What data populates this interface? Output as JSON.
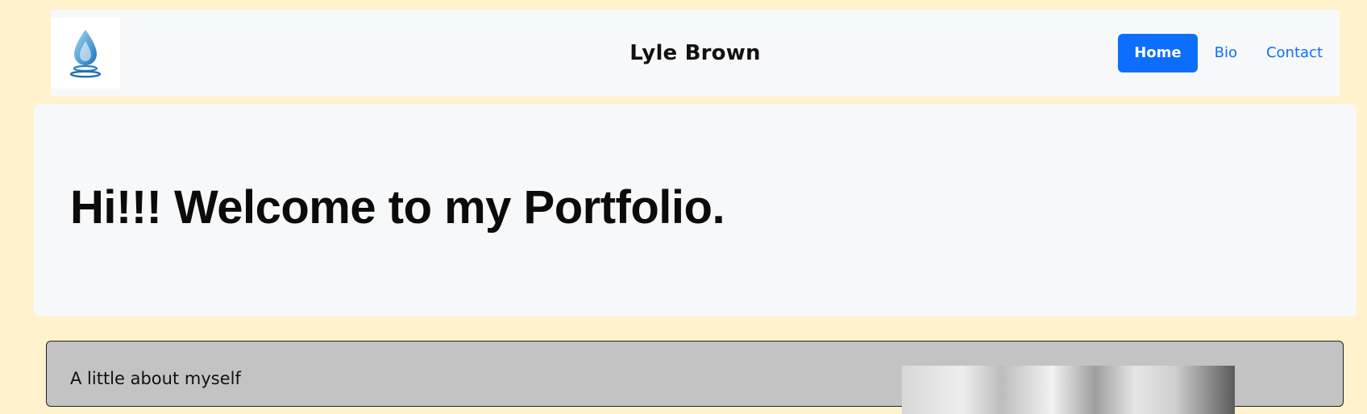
{
  "header": {
    "logo_icon": "water-drop-icon",
    "brand_name": "Lyle Brown",
    "nav": [
      {
        "label": "Home",
        "active": true
      },
      {
        "label": "Bio",
        "active": false
      },
      {
        "label": "Contact",
        "active": false
      }
    ]
  },
  "hero": {
    "title": "Hi!!! Welcome to my Portfolio."
  },
  "about": {
    "heading": "A little about myself"
  },
  "colors": {
    "page_background": "#fff2cc",
    "panel_background": "#f7f8fa",
    "accent": "#0d6efd",
    "about_background": "#c3c3c3"
  }
}
